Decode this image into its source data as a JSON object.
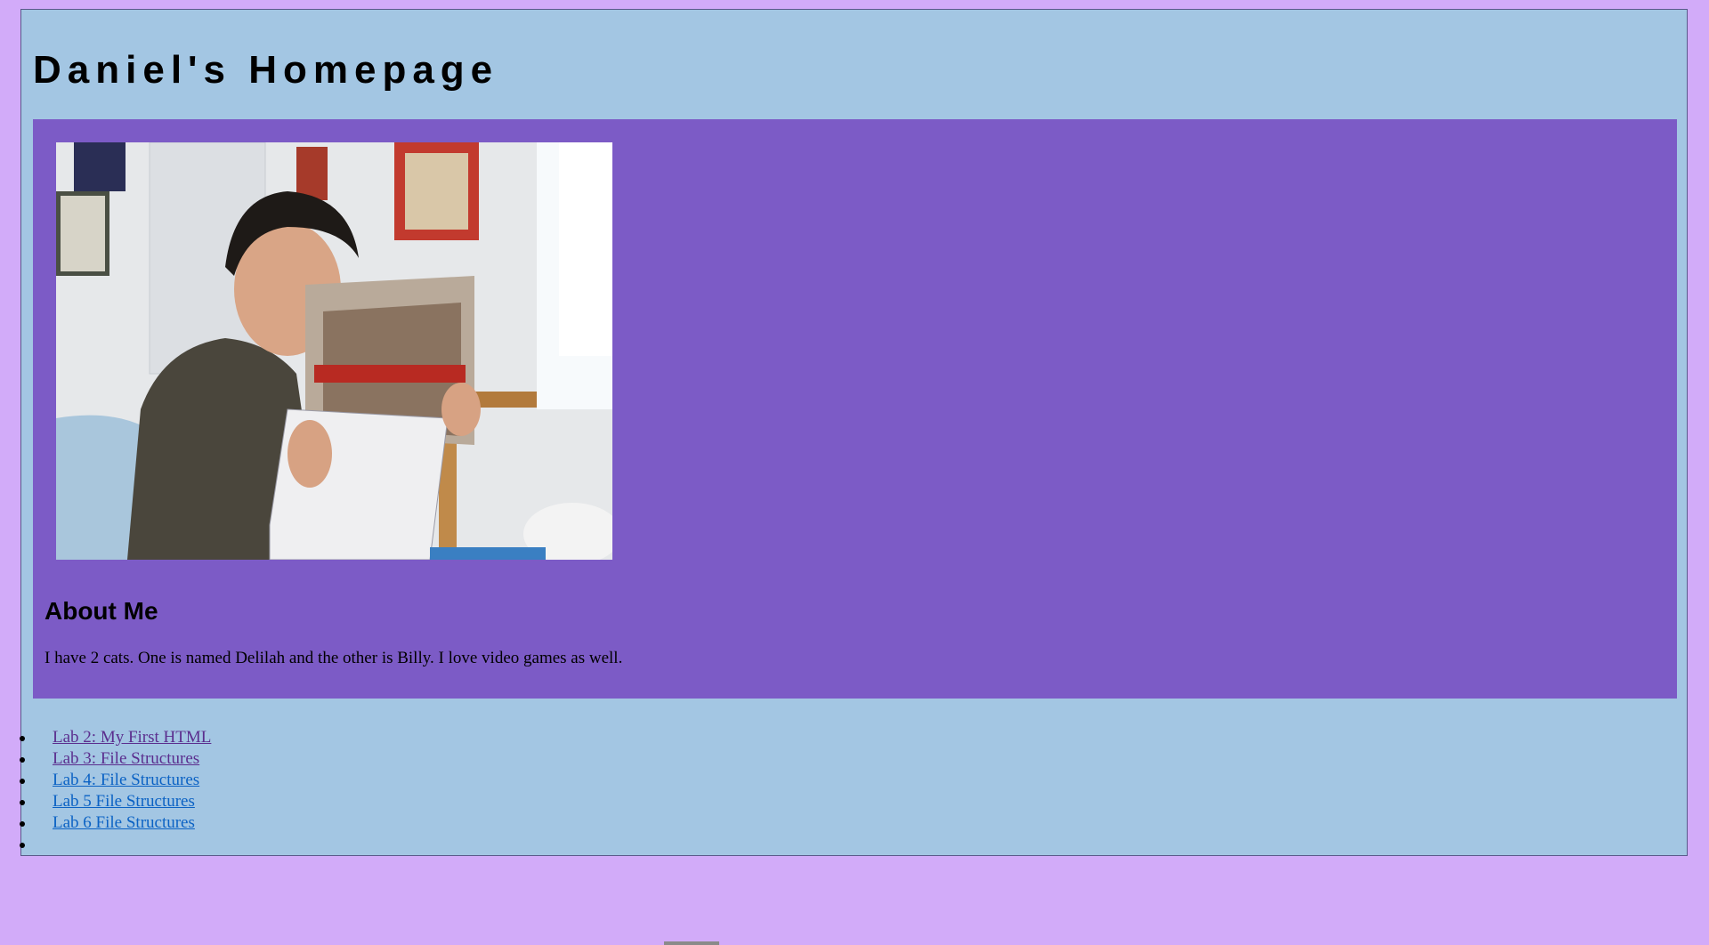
{
  "header": {
    "title": "Daniel's Homepage"
  },
  "profile": {
    "photo_icon": "profile-photo",
    "about_heading": "About Me",
    "about_text": "I have 2 cats. One is named Delilah and the other is Billy. I love video games as well."
  },
  "nav": {
    "links": [
      {
        "label": "Lab 2: My First HTML",
        "visited": true
      },
      {
        "label": "Lab 3: File Structures",
        "visited": true
      },
      {
        "label": "Lab 4: File Structures",
        "visited": false
      },
      {
        "label": "Lab 5 File Structures",
        "visited": false
      },
      {
        "label": "Lab 6 File Structures",
        "visited": false
      }
    ]
  },
  "colors": {
    "page_bg": "#d2abf9",
    "outer_bg": "#a3c6e3",
    "content_bg": "#7c5bc6",
    "link": "#0b62c4",
    "link_visited": "#5b2e8e"
  }
}
